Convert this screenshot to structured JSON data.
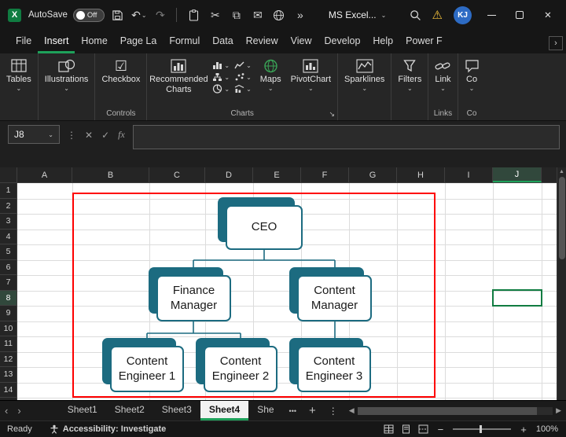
{
  "colors": {
    "accent_green": "#1EA15A",
    "excel_green": "#107C41",
    "org_chart_teal": "#1C6B80",
    "selection_red": "#FE0000",
    "avatar_blue": "#2D6BC4",
    "warning_yellow": "#F6C33C"
  },
  "icons": {
    "chevron_down": "⌄",
    "chevron_double_right": "»",
    "undo": "↶",
    "redo": "↷",
    "scissors": "✂",
    "copy": "⧉",
    "envelope": "✉",
    "warning": "⚠",
    "close": "✕",
    "cancel": "✕",
    "check": "✓",
    "kebab": "⋮",
    "ellipsis": "•••",
    "plus": "+",
    "chevron_left": "‹",
    "chevron_right": "›",
    "scroll_left": "◀",
    "scroll_right": "▶",
    "scroll_up": "▲",
    "checkbox_glyph": "☑",
    "dialog_launcher": "↘",
    "zoom_out": "−",
    "zoom_in": "+",
    "logo_letter": "X"
  },
  "title_bar": {
    "autosave_label": "AutoSave",
    "autosave_state": "Off",
    "app_title": "MS Excel...",
    "avatar_initials": "KJ"
  },
  "menu": {
    "tabs": [
      {
        "label": "File"
      },
      {
        "label": "Insert"
      },
      {
        "label": "Home"
      },
      {
        "label": "Page La"
      },
      {
        "label": "Formul"
      },
      {
        "label": "Data"
      },
      {
        "label": "Review"
      },
      {
        "label": "View"
      },
      {
        "label": "Develop"
      },
      {
        "label": "Help"
      },
      {
        "label": "Power F"
      }
    ]
  },
  "ribbon": {
    "tables_label": "Tables",
    "illustrations_label": "Illustrations",
    "checkbox_label": "Checkbox",
    "recommended_charts_label": "Recommended Charts",
    "maps_label": "Maps",
    "pivotchart_label": "PivotChart",
    "sparklines_label": "Sparklines",
    "filters_label": "Filters",
    "link_label": "Link",
    "comments_label": "Co",
    "group_labels": {
      "controls": "Controls",
      "charts": "Charts",
      "links": "Links",
      "comments": "Co"
    }
  },
  "formula_bar": {
    "name_box": "J8",
    "fx": "fx",
    "formula_value": ""
  },
  "grid": {
    "columns": [
      "A",
      "B",
      "C",
      "D",
      "E",
      "F",
      "G",
      "H",
      "I",
      "J"
    ],
    "rows": [
      "1",
      "2",
      "3",
      "4",
      "5",
      "6",
      "7",
      "8",
      "9",
      "10",
      "11",
      "12",
      "13",
      "14"
    ],
    "selected_cell": "J8"
  },
  "org_chart": {
    "nodes": [
      {
        "id": "ceo",
        "label": "CEO"
      },
      {
        "id": "finance-manager",
        "label": "Finance Manager"
      },
      {
        "id": "content-manager",
        "label": "Content Manager"
      },
      {
        "id": "content-engineer-1",
        "label": "Content Engineer 1"
      },
      {
        "id": "content-engineer-2",
        "label": "Content Engineer 2"
      },
      {
        "id": "content-engineer-3",
        "label": "Content Engineer 3"
      }
    ]
  },
  "sheet_tabs": {
    "tabs": [
      {
        "label": "Sheet1"
      },
      {
        "label": "Sheet2"
      },
      {
        "label": "Sheet3"
      },
      {
        "label": "Sheet4"
      },
      {
        "label": "She"
      }
    ]
  },
  "status_bar": {
    "ready": "Ready",
    "accessibility": "Accessibility: Investigate",
    "zoom_level": "100%"
  }
}
